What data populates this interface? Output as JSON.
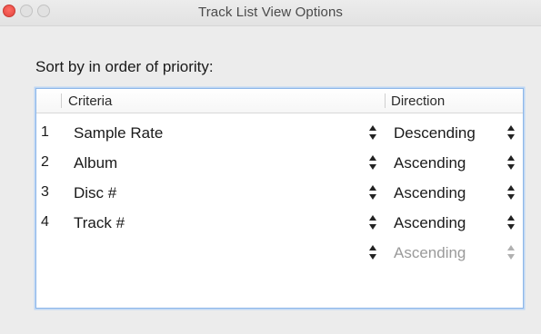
{
  "window": {
    "title": "Track List View Options"
  },
  "sort": {
    "label": "Sort by in order of priority:"
  },
  "table": {
    "columns": {
      "criteria": "Criteria",
      "direction": "Direction"
    },
    "rows": [
      {
        "number": "1",
        "criteria": "Sample Rate",
        "direction": "Descending"
      },
      {
        "number": "2",
        "criteria": "Album",
        "direction": "Ascending"
      },
      {
        "number": "3",
        "criteria": "Disc #",
        "direction": "Ascending"
      },
      {
        "number": "4",
        "criteria": "Track #",
        "direction": "Ascending"
      },
      {
        "number": "",
        "criteria": "",
        "direction": "Ascending"
      }
    ]
  },
  "icons": {
    "close": "close-icon",
    "minimize": "minimize-icon",
    "zoom": "zoom-icon",
    "stepper": "up-down-arrows-icon"
  },
  "colors": {
    "close_red": "#e0443e",
    "focus_ring": "#8fb7e8",
    "disabled_text": "#9a9a9a"
  }
}
